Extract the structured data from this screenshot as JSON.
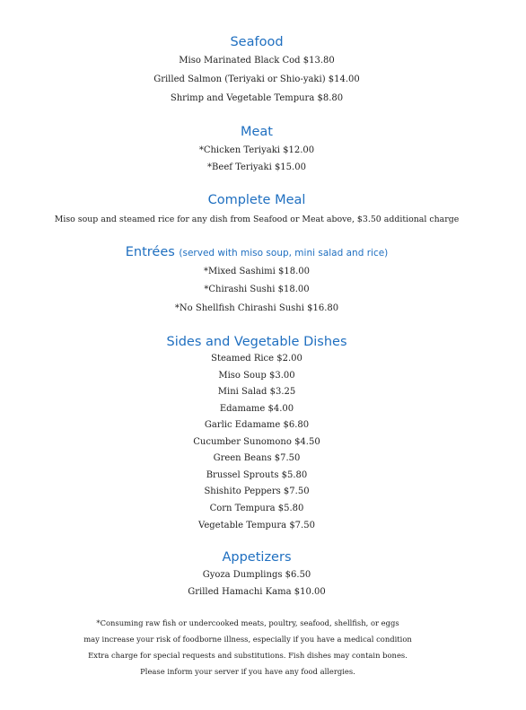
{
  "sections": {
    "seafood": {
      "title": "Seafood",
      "items": [
        "Miso Marinated Black Cod  $13.80",
        "Grilled Salmon (Teriyaki or Shio-yaki)  $14.00",
        "Shrimp and Vegetable Tempura  $8.80"
      ]
    },
    "meat": {
      "title": "Meat",
      "items": [
        "*Chicken Teriyaki  $12.00",
        "*Beef Teriyaki  $15.00"
      ]
    },
    "complete_meal": {
      "title": "Complete Meal",
      "items": [
        "Miso soup and steamed rice for any dish from Seafood or Meat above, $3.50 additional charge"
      ]
    },
    "entrees": {
      "title": "Entrées",
      "subtitle": "(served with miso soup, mini salad and rice)",
      "items": [
        "*Mixed Sashimi  $18.00",
        "*Chirashi Sushi  $18.00",
        "*No Shellfish Chirashi Sushi  $16.80"
      ]
    },
    "sides": {
      "title": "Sides and Vegetable Dishes",
      "items": [
        "Steamed Rice  $2.00",
        "Miso Soup  $3.00",
        "Mini Salad  $3.25",
        "Edamame  $4.00",
        "Garlic Edamame  $6.80",
        "Cucumber Sunomono  $4.50",
        "Green Beans  $7.50",
        "Brussel Sprouts  $5.80",
        "Shishito Peppers  $7.50",
        "Corn Tempura  $5.80",
        "Vegetable Tempura  $7.50"
      ]
    },
    "appetizers": {
      "title": "Appetizers",
      "items": [
        "Gyoza Dumplings  $6.50",
        "Grilled Hamachi Kama  $10.00"
      ]
    }
  },
  "footer": [
    "*Consuming raw fish or undercooked meats, poultry, seafood, shellfish, or eggs",
    "may increase your risk of foodborne illness, especially if you have a medical condition",
    "Extra charge for special requests and substitutions. Fish dishes may contain bones.",
    "Please inform your server if you have any food allergies."
  ]
}
